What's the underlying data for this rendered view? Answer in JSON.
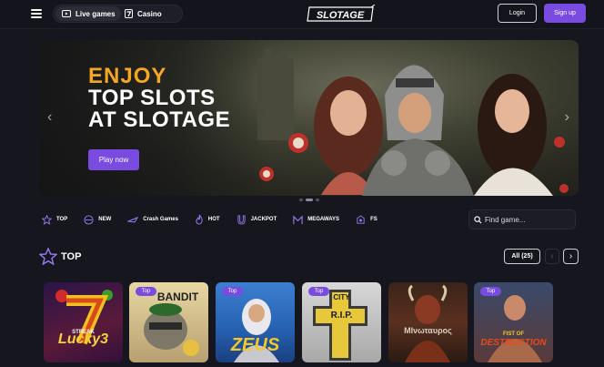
{
  "header": {
    "live_games_label": "Live games",
    "casino_label": "Casino",
    "logo_text": "SLOTAGE",
    "login_label": "Login",
    "signup_label": "Sign up"
  },
  "hero": {
    "line1": "ENJOY",
    "line2": "TOP SLOTS",
    "line3": "AT SLOTAGE",
    "cta_label": "Play now",
    "slide_count": 3,
    "active_slide": 2
  },
  "categories": [
    {
      "label": "TOP",
      "icon": "star-icon"
    },
    {
      "label": "NEW",
      "icon": "new-icon"
    },
    {
      "label": "Crash Games",
      "icon": "plane-icon"
    },
    {
      "label": "HOT",
      "icon": "flame-icon"
    },
    {
      "label": "JACKPOT",
      "icon": "magnet-icon"
    },
    {
      "label": "MEGAWAYS",
      "icon": "megaways-icon"
    },
    {
      "label": "FS",
      "icon": "free-spins-icon"
    }
  ],
  "search": {
    "placeholder": "Find game..."
  },
  "section": {
    "title": "TOP",
    "all_label": "All (25)"
  },
  "games": [
    {
      "name": "Lucky Streak 3",
      "title": "Lucky3",
      "subtitle": "STREAK",
      "badge": ""
    },
    {
      "name": "Le Bandit",
      "title": "BANDIT",
      "subtitle": "LE",
      "badge": "Top"
    },
    {
      "name": "Zeus",
      "title": "ZEUS",
      "subtitle": "",
      "badge": "Top"
    },
    {
      "name": "R.I.P. City",
      "title": "R.I.P.",
      "subtitle": "CITY",
      "badge": "Top"
    },
    {
      "name": "Minotauros",
      "title": "MIνωταυρος",
      "subtitle": "",
      "badge": ""
    },
    {
      "name": "Fist of Destruction",
      "title": "DESTRUCTION",
      "subtitle": "FIST OF",
      "badge": "Top"
    }
  ],
  "colors": {
    "accent": "#7a4be0",
    "hero_highlight": "#f5a623",
    "background": "#16161f"
  }
}
